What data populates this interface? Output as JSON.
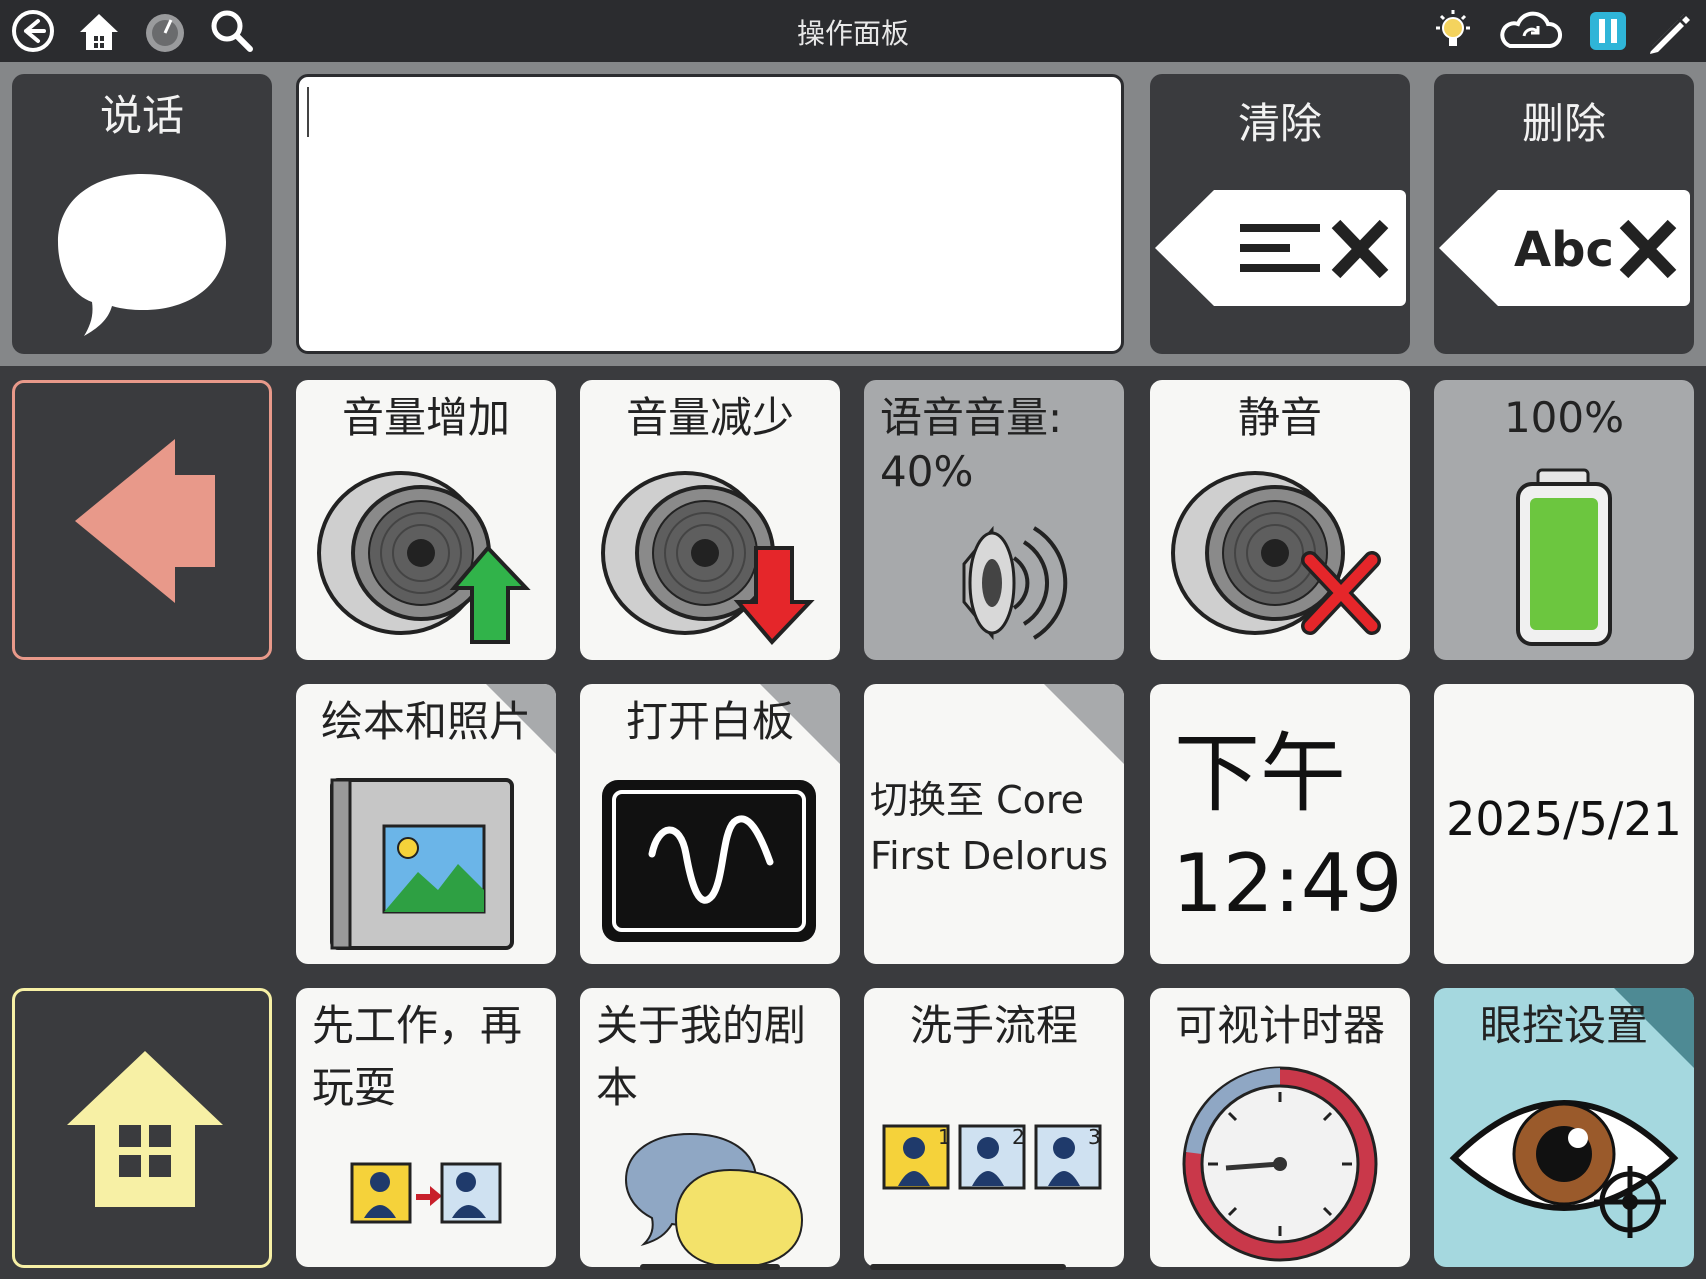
{
  "app": {
    "title": "操作面板"
  },
  "top_icons": [
    "back-icon",
    "home-icon",
    "dashboard-icon",
    "search-icon",
    "lightbulb-icon",
    "cloud-sync-icon",
    "pause-icon",
    "edit-icon"
  ],
  "message_bar": {
    "speak_label": "说话",
    "text_value": "",
    "clear_label": "清除",
    "delete_label": "删除"
  },
  "row1": {
    "volume_up": "音量增加",
    "volume_down": "音量减少",
    "voice_volume": "语音音量:",
    "voice_volume_value": "40%",
    "mute": "静音",
    "battery": "100%"
  },
  "row2": {
    "books": "绘本和照片",
    "whiteboard": "打开白板",
    "switch_line1": "切换至 Core",
    "switch_line2": "First Delorus",
    "time_period": "下午",
    "time": "12:49",
    "date": "2025/5/21"
  },
  "row3": {
    "first_then_line1": "先工作，再",
    "first_then_line2": "玩耍",
    "social_story_line1": "关于我的剧",
    "social_story_line2": "本",
    "handwashing": "洗手流程",
    "timer": "可视计时器",
    "eye_gaze": "眼控设置"
  },
  "handwashing_steps": [
    "1",
    "2",
    "3"
  ],
  "colors": {
    "back_arrow": "#e8998a",
    "home": "#f7f0a5",
    "battery": "#6cc63f",
    "up_arrow": "#31b34a",
    "down_arrow": "#e5262a",
    "timer_red": "#c9384a",
    "timer_blue": "#8fa7c4"
  }
}
